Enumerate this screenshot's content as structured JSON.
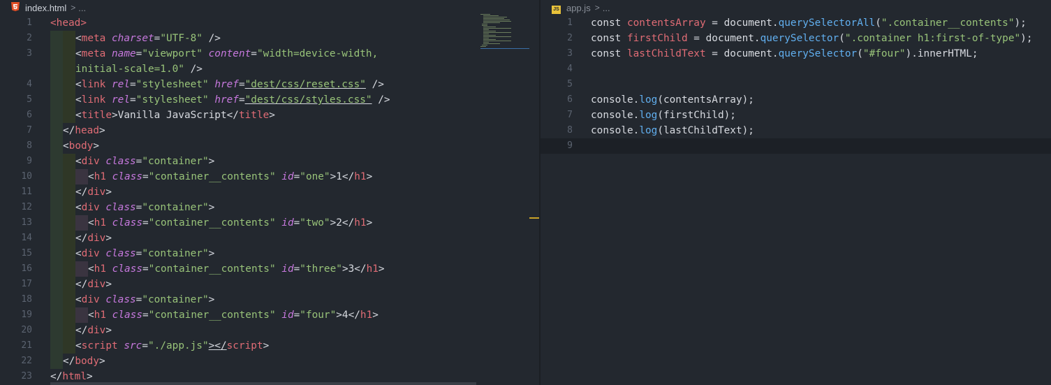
{
  "left": {
    "crumb_file": "index.html",
    "crumb_sep": ">",
    "crumb_more": "...",
    "icon": "html5-icon"
  },
  "right": {
    "crumb_file": "app.js",
    "crumb_sep": ">",
    "crumb_more": "...",
    "icon": "js-file-icon",
    "icon_label": "JS"
  },
  "colors": {
    "tag": "#e06c75",
    "attr": "#c678dd",
    "string": "#98c379",
    "function": "#61afef",
    "text": "#d7dae0"
  },
  "html_lines": [
    {
      "n": "1",
      "t": [
        [
          "tag",
          "<head>"
        ]
      ]
    },
    {
      "n": "2",
      "t": [
        [
          "p",
          "<"
        ],
        [
          "tag",
          "meta "
        ],
        [
          "attr",
          "charset"
        ],
        [
          "p",
          "="
        ],
        [
          "str",
          "\"UTF-8\""
        ],
        [
          "p",
          " />"
        ]
      ]
    },
    {
      "n": "3",
      "t": [
        [
          "p",
          "<"
        ],
        [
          "tag",
          "meta "
        ],
        [
          "attr",
          "name"
        ],
        [
          "p",
          "="
        ],
        [
          "str",
          "\"viewport\" "
        ],
        [
          "attr",
          "content"
        ],
        [
          "p",
          "="
        ],
        [
          "str",
          "\"width=device-width,"
        ]
      ]
    },
    {
      "n": "",
      "t": [
        [
          "str",
          "initial-scale=1.0\""
        ],
        [
          "p",
          " />"
        ]
      ]
    },
    {
      "n": "4",
      "t": [
        [
          "p",
          "<"
        ],
        [
          "tag",
          "link "
        ],
        [
          "attr",
          "rel"
        ],
        [
          "p",
          "="
        ],
        [
          "str",
          "\"stylesheet\" "
        ],
        [
          "attr",
          "href"
        ],
        [
          "p",
          "="
        ],
        [
          "str",
          "\"dest/css/reset.css\""
        ],
        [
          "p",
          " />"
        ]
      ]
    },
    {
      "n": "5",
      "t": [
        [
          "p",
          "<"
        ],
        [
          "tag",
          "link "
        ],
        [
          "attr",
          "rel"
        ],
        [
          "p",
          "="
        ],
        [
          "str",
          "\"stylesheet\" "
        ],
        [
          "attr",
          "href"
        ],
        [
          "p",
          "="
        ],
        [
          "str",
          "\"dest/css/styles.css\""
        ],
        [
          "p",
          " />"
        ]
      ]
    },
    {
      "n": "6",
      "t": [
        [
          "p",
          "<"
        ],
        [
          "tag",
          "title"
        ],
        [
          "p",
          ">Vanilla JavaScript</"
        ],
        [
          "tag",
          "title"
        ],
        [
          "p",
          ">"
        ]
      ]
    },
    {
      "n": "7",
      "t": [
        [
          "p",
          "</"
        ],
        [
          "tag",
          "head"
        ],
        [
          "p",
          ">"
        ]
      ]
    },
    {
      "n": "8",
      "t": [
        [
          "p",
          "<"
        ],
        [
          "tag",
          "body"
        ],
        [
          "p",
          ">"
        ]
      ]
    },
    {
      "n": "9",
      "t": [
        [
          "p",
          "<"
        ],
        [
          "tag",
          "div "
        ],
        [
          "attr",
          "class"
        ],
        [
          "p",
          "="
        ],
        [
          "str",
          "\"container\""
        ],
        [
          "p",
          ">"
        ]
      ]
    },
    {
      "n": "10",
      "t": [
        [
          "p",
          "<"
        ],
        [
          "tag",
          "h1 "
        ],
        [
          "attr",
          "class"
        ],
        [
          "p",
          "="
        ],
        [
          "str",
          "\"container__contents\" "
        ],
        [
          "attr",
          "id"
        ],
        [
          "p",
          "="
        ],
        [
          "str",
          "\"one\""
        ],
        [
          "p",
          ">1</"
        ],
        [
          "tag",
          "h1"
        ],
        [
          "p",
          ">"
        ]
      ]
    },
    {
      "n": "11",
      "t": [
        [
          "p",
          "</"
        ],
        [
          "tag",
          "div"
        ],
        [
          "p",
          ">"
        ]
      ]
    },
    {
      "n": "12",
      "t": [
        [
          "p",
          "<"
        ],
        [
          "tag",
          "div "
        ],
        [
          "attr",
          "class"
        ],
        [
          "p",
          "="
        ],
        [
          "str",
          "\"container\""
        ],
        [
          "p",
          ">"
        ]
      ]
    },
    {
      "n": "13",
      "t": [
        [
          "p",
          "<"
        ],
        [
          "tag",
          "h1 "
        ],
        [
          "attr",
          "class"
        ],
        [
          "p",
          "="
        ],
        [
          "str",
          "\"container__contents\" "
        ],
        [
          "attr",
          "id"
        ],
        [
          "p",
          "="
        ],
        [
          "str",
          "\"two\""
        ],
        [
          "p",
          ">2</"
        ],
        [
          "tag",
          "h1"
        ],
        [
          "p",
          ">"
        ]
      ]
    },
    {
      "n": "14",
      "t": [
        [
          "p",
          "</"
        ],
        [
          "tag",
          "div"
        ],
        [
          "p",
          ">"
        ]
      ]
    },
    {
      "n": "15",
      "t": [
        [
          "p",
          "<"
        ],
        [
          "tag",
          "div "
        ],
        [
          "attr",
          "class"
        ],
        [
          "p",
          "="
        ],
        [
          "str",
          "\"container\""
        ],
        [
          "p",
          ">"
        ]
      ]
    },
    {
      "n": "16",
      "t": [
        [
          "p",
          "<"
        ],
        [
          "tag",
          "h1 "
        ],
        [
          "attr",
          "class"
        ],
        [
          "p",
          "="
        ],
        [
          "str",
          "\"container__contents\" "
        ],
        [
          "attr",
          "id"
        ],
        [
          "p",
          "="
        ],
        [
          "str",
          "\"three\""
        ],
        [
          "p",
          ">3</"
        ],
        [
          "tag",
          "h1"
        ],
        [
          "p",
          ">"
        ]
      ]
    },
    {
      "n": "17",
      "t": [
        [
          "p",
          "</"
        ],
        [
          "tag",
          "div"
        ],
        [
          "p",
          ">"
        ]
      ]
    },
    {
      "n": "18",
      "t": [
        [
          "p",
          "<"
        ],
        [
          "tag",
          "div "
        ],
        [
          "attr",
          "class"
        ],
        [
          "p",
          "="
        ],
        [
          "str",
          "\"container\""
        ],
        [
          "p",
          ">"
        ]
      ]
    },
    {
      "n": "19",
      "t": [
        [
          "p",
          "<"
        ],
        [
          "tag",
          "h1 "
        ],
        [
          "attr",
          "class"
        ],
        [
          "p",
          "="
        ],
        [
          "str",
          "\"container__contents\" "
        ],
        [
          "attr",
          "id"
        ],
        [
          "p",
          "="
        ],
        [
          "str",
          "\"four\""
        ],
        [
          "p",
          ">4</"
        ],
        [
          "tag",
          "h1"
        ],
        [
          "p",
          ">"
        ]
      ]
    },
    {
      "n": "20",
      "t": [
        [
          "p",
          "</"
        ],
        [
          "tag",
          "div"
        ],
        [
          "p",
          ">"
        ]
      ]
    },
    {
      "n": "21",
      "t": [
        [
          "p",
          "<"
        ],
        [
          "tag",
          "script "
        ],
        [
          "attr",
          "src"
        ],
        [
          "p",
          "="
        ],
        [
          "str",
          "\"./app.js\""
        ],
        [
          "p",
          "></"
        ],
        [
          "tag",
          "script"
        ],
        [
          "p",
          ">"
        ]
      ]
    },
    {
      "n": "22",
      "t": [
        [
          "p",
          "</"
        ],
        [
          "tag",
          "body"
        ],
        [
          "p",
          ">"
        ]
      ]
    },
    {
      "n": "23",
      "t": [
        [
          "p",
          "</"
        ],
        [
          "tag",
          "html"
        ],
        [
          "p",
          ">"
        ]
      ]
    }
  ],
  "js_lines": [
    {
      "n": "1",
      "t": [
        [
          "kw",
          "const "
        ],
        [
          "var",
          "contentsArray"
        ],
        [
          "p",
          " = document."
        ],
        [
          "fn",
          "querySelectorAll"
        ],
        [
          "p",
          "("
        ],
        [
          "str",
          "\".container__contents\""
        ],
        [
          "p",
          ");"
        ]
      ]
    },
    {
      "n": "2",
      "t": [
        [
          "kw",
          "const "
        ],
        [
          "var",
          "firstChild"
        ],
        [
          "p",
          " = document."
        ],
        [
          "fn",
          "querySelector"
        ],
        [
          "p",
          "("
        ],
        [
          "str",
          "\".container h1:first-of-type\""
        ],
        [
          "p",
          ");"
        ]
      ]
    },
    {
      "n": "3",
      "t": [
        [
          "kw",
          "const "
        ],
        [
          "var",
          "lastChildText"
        ],
        [
          "p",
          " = document."
        ],
        [
          "fn",
          "querySelector"
        ],
        [
          "p",
          "("
        ],
        [
          "str",
          "\"#four\""
        ],
        [
          "p",
          ").innerHTML;"
        ]
      ]
    },
    {
      "n": "4",
      "t": []
    },
    {
      "n": "5",
      "t": []
    },
    {
      "n": "6",
      "t": [
        [
          "p",
          "console."
        ],
        [
          "fn",
          "log"
        ],
        [
          "p",
          "(contentsArray);"
        ]
      ]
    },
    {
      "n": "7",
      "t": [
        [
          "p",
          "console."
        ],
        [
          "fn",
          "log"
        ],
        [
          "p",
          "(firstChild);"
        ]
      ]
    },
    {
      "n": "8",
      "t": [
        [
          "p",
          "console."
        ],
        [
          "fn",
          "log"
        ],
        [
          "p",
          "(lastChildText);"
        ]
      ]
    },
    {
      "n": "9",
      "t": []
    }
  ]
}
